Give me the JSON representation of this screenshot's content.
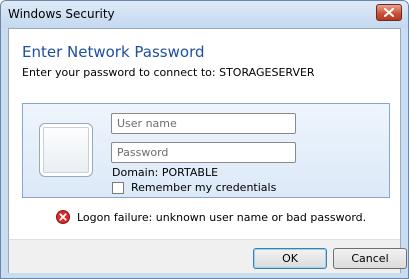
{
  "window": {
    "title": "Windows Security",
    "close_icon": "close-icon"
  },
  "dialog": {
    "heading": "Enter Network Password",
    "subheading": "Enter your password to connect to: STORAGESERVER"
  },
  "credentials": {
    "username_placeholder": "User name",
    "username_value": "",
    "password_placeholder": "Password",
    "password_value": "",
    "domain": "Domain: PORTABLE",
    "remember_label": "Remember my credentials",
    "remember_checked": false
  },
  "error": {
    "icon": "error-icon",
    "message": "Logon failure: unknown user name or bad password."
  },
  "buttons": {
    "ok_label": "OK",
    "cancel_label": "Cancel"
  },
  "colors": {
    "heading": "#1e4fa0",
    "close_button": "#c9533b",
    "error_icon": "#d42b2b",
    "panel_border": "#86a6cf"
  }
}
